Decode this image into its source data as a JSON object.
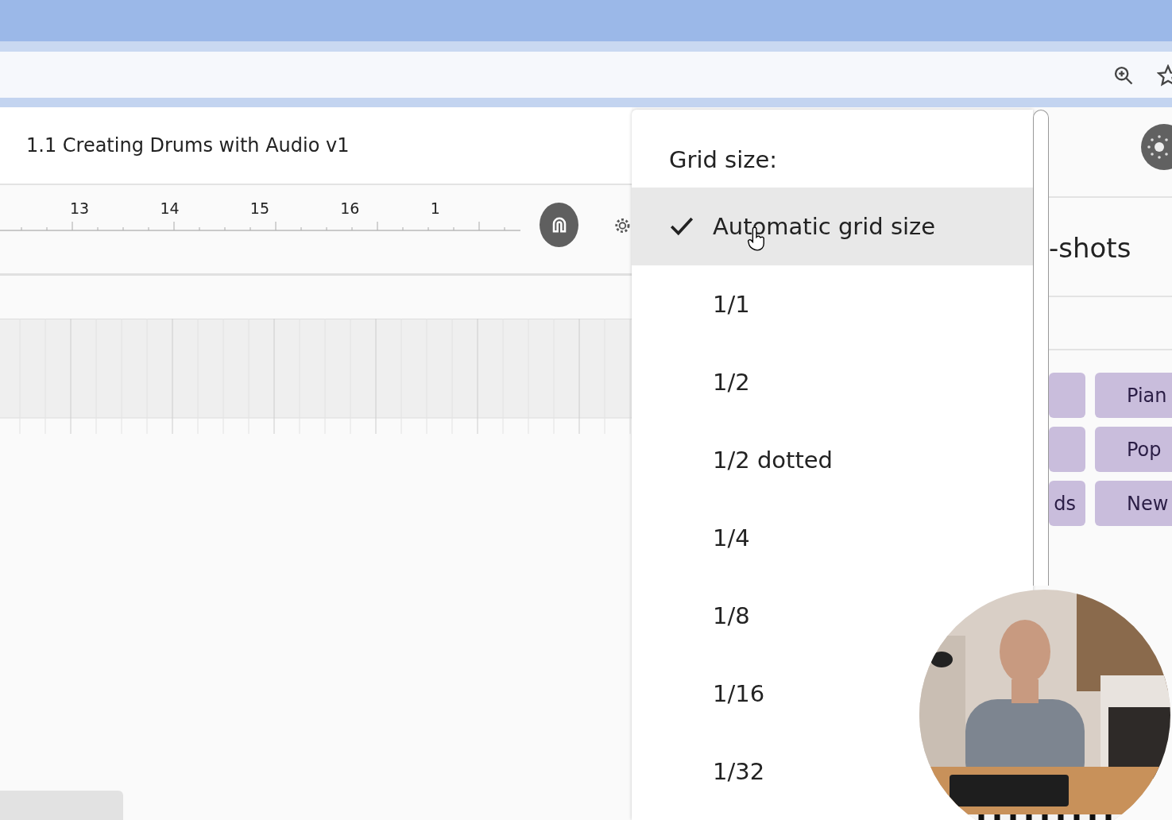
{
  "project": {
    "title": "1.1 Creating Drums with Audio v1"
  },
  "ruler": {
    "bars": [
      "13",
      "14",
      "15",
      "16",
      "1"
    ]
  },
  "grid_menu": {
    "title": "Grid size:",
    "items": [
      {
        "label": "Automatic grid size",
        "selected": true
      },
      {
        "label": "1/1",
        "selected": false
      },
      {
        "label": "1/2",
        "selected": false
      },
      {
        "label": "1/2 dotted",
        "selected": false
      },
      {
        "label": "1/4",
        "selected": false
      },
      {
        "label": "1/8",
        "selected": false
      },
      {
        "label": "1/16",
        "selected": false
      },
      {
        "label": "1/32",
        "selected": false
      }
    ]
  },
  "right_panel": {
    "heading": "-shots",
    "chip_rows": [
      {
        "column_2": "Pian"
      },
      {
        "column_2": "Pop"
      },
      {
        "column_1": "ds",
        "column_2": "New"
      }
    ]
  }
}
